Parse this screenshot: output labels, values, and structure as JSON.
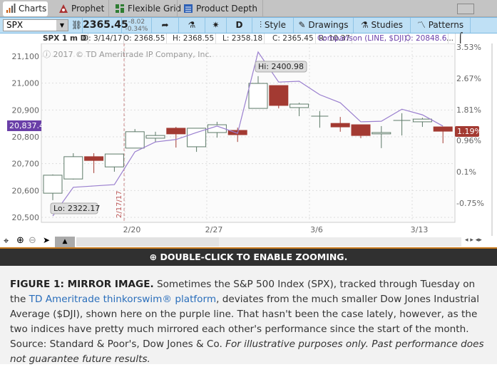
{
  "tabs": [
    {
      "label": "Charts",
      "icon": "bar-chart-icon"
    },
    {
      "label": "Prophet",
      "icon": "prophet-icon"
    },
    {
      "label": "Flexible Grid",
      "icon": "grid-icon"
    },
    {
      "label": "Product Depth",
      "icon": "depth-icon"
    }
  ],
  "toolbar": {
    "symbol": "SPX",
    "price": "2365.45",
    "change": "-8.02",
    "change_pct": "-0.34%",
    "period": "D",
    "style": "Style",
    "drawings": "Drawings",
    "studies": "Studies",
    "patterns": "Patterns"
  },
  "info": {
    "title": "SPX 1 m D",
    "date": "D: 3/14/17",
    "open": "O: 2368.55",
    "high": "H: 2368.55",
    "low": "L: 2358.18",
    "close": "C: 2365.45",
    "range": "R: 10.37",
    "comparison": "Comparison (LINE, $DJI)",
    "comp_open": "O: 20848.6",
    "more": "..."
  },
  "chart": {
    "watermark": "2017 © TD Ameritrade IP Company, Inc.",
    "hi_label": "Hi: 2400.98",
    "lo_label": "Lo: 2322.17",
    "marker_label": "2/17/17",
    "left_tag": "20,837.4",
    "right_tag": "1.19%"
  },
  "chart_data": {
    "type": "candlestick",
    "left_axis": {
      "ticks": [
        "21,100",
        "21,000",
        "20,900",
        "20,800",
        "20,700",
        "20,600",
        "20,500"
      ],
      "values": [
        21100,
        21000,
        20900,
        20800,
        20700,
        20600,
        20500
      ],
      "range": [
        20500,
        21100
      ]
    },
    "right_axis": {
      "ticks": [
        "3.53%",
        "2.67%",
        "1.81%",
        "0.96%",
        "0.1%",
        "-0.75%"
      ]
    },
    "x_ticks": [
      {
        "label": "2/20",
        "index": 4
      },
      {
        "label": "2/27",
        "index": 8
      },
      {
        "label": "3/6",
        "index": 13
      },
      {
        "label": "3/13",
        "index": 18
      }
    ],
    "candles": [
      [
        20590,
        20660,
        20564,
        20657
      ],
      [
        20643,
        20739,
        20641,
        20726
      ],
      [
        20726,
        20739,
        20665,
        20712
      ],
      [
        20688,
        20736,
        20670,
        20736
      ],
      [
        20758,
        20829,
        20758,
        20819
      ],
      [
        20795,
        20819,
        20779,
        20805
      ],
      [
        20832,
        20837,
        20760,
        20811
      ],
      [
        20763,
        20832,
        20744,
        20832
      ],
      [
        20816,
        20856,
        20797,
        20845
      ],
      [
        20824,
        20834,
        20781,
        20808
      ],
      [
        20906,
        21026,
        20906,
        20999
      ],
      [
        20991,
        20991,
        20906,
        20917
      ],
      [
        20909,
        20927,
        20877,
        20922
      ],
      [
        20877,
        20896,
        20834,
        20877
      ],
      [
        20850,
        20874,
        20819,
        20837
      ],
      [
        20845,
        20845,
        20795,
        20805
      ],
      [
        20811,
        20840,
        20758,
        20816
      ],
      [
        20861,
        20888,
        20805,
        20861
      ],
      [
        20856,
        20871,
        20837,
        20866
      ],
      [
        20837,
        20837,
        20776,
        20821
      ]
    ],
    "comparison_line": [
      20505,
      20612,
      20617,
      20622,
      20744,
      20781,
      20790,
      20816,
      20840,
      20813,
      21116,
      21004,
      21007,
      20957,
      20927,
      20856,
      20858,
      20903,
      20882,
      20840
    ],
    "colors": {
      "up": "#5d7a68",
      "down": "#a33a32",
      "line": "#9a7fcf",
      "tag_left": "#6a3fa8",
      "tag_right": "#a33a32"
    }
  },
  "banner": {
    "label": "DOUBLE-CLICK TO ENABLE ZOOMING.",
    "icon": "zoom-icon"
  },
  "caption": {
    "bold": "FIGURE 1: MIRROR IMAGE.",
    "t1": " Sometimes the S&P 500 Index (SPX), tracked through Tuesday on the ",
    "link": "TD Ameritrade thinkorswim® platform",
    "t2": ", deviates from the much smaller Dow Jones Industrial Average ($DJI), shown here on the purple line. That hasn't been the case lately, however, as the two indices have pretty much mirrored each other's performance since the start of the month. Source: Standard & Poor's, Dow Jones & Co. ",
    "italic": "For illustrative purposes only. Past performance does not guarantee future results."
  }
}
